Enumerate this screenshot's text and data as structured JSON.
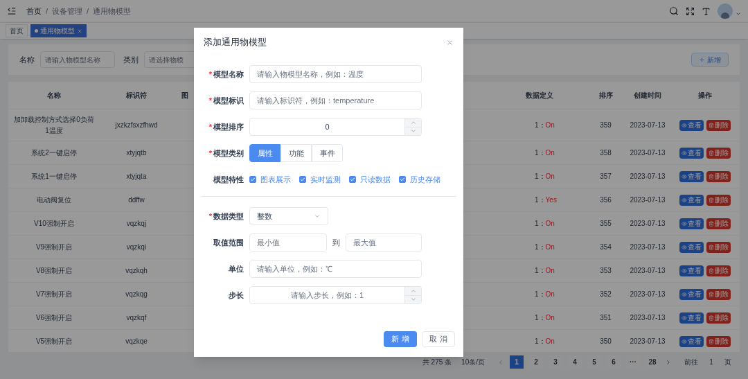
{
  "header": {
    "breadcrumb": [
      "首页",
      "设备管理",
      "通用物模型"
    ],
    "breadcrumb_separator": "/"
  },
  "tabs": [
    {
      "label": "首页",
      "selected": false
    },
    {
      "label": "通用物模型",
      "selected": true
    }
  ],
  "search": {
    "fields": [
      {
        "label": "名称",
        "placeholder": "请输入物模型名称"
      },
      {
        "label": "类别",
        "placeholder": "请选择物模"
      }
    ],
    "add_button": "新增"
  },
  "table": {
    "columns": [
      "名称",
      "标识符",
      "图",
      "数据定义",
      "排序",
      "创建时间",
      "操作"
    ],
    "rows": [
      {
        "name": "加卸载控制方式选择0负荷1温度",
        "identifier": "jxzkzfsxzfhwd",
        "data_key": "1：",
        "data_value": "On",
        "sort": "359",
        "created": "2023-07-13",
        "actions": [
          "查看",
          "删除"
        ]
      },
      {
        "name": "系统2一键启停",
        "identifier": "xtyjqtb",
        "data_key": "1：",
        "data_value": "On",
        "sort": "358",
        "created": "2023-07-13",
        "actions": [
          "查看",
          "删除"
        ]
      },
      {
        "name": "系统1一键启停",
        "identifier": "xtyjqta",
        "data_key": "1：",
        "data_value": "On",
        "sort": "357",
        "created": "2023-07-13",
        "actions": [
          "查看",
          "删除"
        ]
      },
      {
        "name": "电动阀复位",
        "identifier": "ddffw",
        "data_key": "1：",
        "data_value": "Yes",
        "sort": "356",
        "created": "2023-07-13",
        "actions": [
          "查看",
          "删除"
        ]
      },
      {
        "name": "V10强制开启",
        "identifier": "vqzkqj",
        "data_key": "1：",
        "data_value": "On",
        "sort": "355",
        "created": "2023-07-13",
        "actions": [
          "查看",
          "删除"
        ]
      },
      {
        "name": "V9强制开启",
        "identifier": "vqzkqi",
        "data_key": "1：",
        "data_value": "On",
        "sort": "354",
        "created": "2023-07-13",
        "actions": [
          "查看",
          "删除"
        ]
      },
      {
        "name": "V8强制开启",
        "identifier": "vqzkqh",
        "data_key": "1：",
        "data_value": "On",
        "sort": "353",
        "created": "2023-07-13",
        "actions": [
          "查看",
          "删除"
        ]
      },
      {
        "name": "V7强制开启",
        "identifier": "vqzkqg",
        "data_key": "1：",
        "data_value": "On",
        "sort": "352",
        "created": "2023-07-13",
        "actions": [
          "查看",
          "删除"
        ]
      },
      {
        "name": "V6强制开启",
        "identifier": "vqzkqf",
        "data_key": "1：",
        "data_value": "On",
        "sort": "351",
        "created": "2023-07-13",
        "actions": [
          "查看",
          "删除"
        ]
      },
      {
        "name": "V5强制开启",
        "identifier": "vqzkqe",
        "data_key": "1：",
        "data_value": "On",
        "sort": "350",
        "created": "2023-07-13",
        "actions": [
          "查看",
          "删除"
        ]
      }
    ]
  },
  "pagination": {
    "total": "共 275 条",
    "page_size": "10条/页",
    "pages": [
      {
        "label": "1",
        "selected": true
      },
      {
        "label": "2",
        "selected": false
      },
      {
        "label": "3",
        "selected": false
      },
      {
        "label": "4",
        "selected": false
      },
      {
        "label": "5",
        "selected": false
      },
      {
        "label": "6",
        "selected": false
      },
      {
        "label": "···",
        "selected": false
      },
      {
        "label": "28",
        "selected": false
      }
    ],
    "goto_label": "前往",
    "goto_value": "1",
    "goto_suffix": "页"
  },
  "dialog": {
    "title": "添加通用物模型",
    "required_mark": "*",
    "sections": [
      [
        {
          "kind": "text",
          "label": "模型名称",
          "required": true,
          "placeholder": "请输入物模型名称，例如：温度"
        },
        {
          "kind": "text",
          "label": "模型标识",
          "required": true,
          "placeholder": "请输入标识符，例如：temperature"
        },
        {
          "kind": "number",
          "label": "模型排序",
          "required": true,
          "value": "0"
        },
        {
          "kind": "segmented",
          "label": "模型类别",
          "required": true,
          "options": [
            {
              "label": "属性",
              "selected": true
            },
            {
              "label": "功能",
              "selected": false
            },
            {
              "label": "事件",
              "selected": false
            }
          ]
        },
        {
          "kind": "checkboxes",
          "label": "模型特性",
          "required": false,
          "options": [
            {
              "label": "图表展示",
              "checked": true
            },
            {
              "label": "实时监测",
              "checked": true
            },
            {
              "label": "只读数据",
              "checked": true
            },
            {
              "label": "历史存储",
              "checked": true
            }
          ]
        }
      ],
      [
        {
          "kind": "select",
          "label": "数据类型",
          "required": true,
          "value": "整数"
        },
        {
          "kind": "range",
          "label": "取值范围",
          "required": false,
          "min_placeholder": "最小值",
          "separator": "到",
          "max_placeholder": "最大值"
        },
        {
          "kind": "text",
          "label": "单位",
          "required": false,
          "placeholder": "请输入单位，例如：℃"
        },
        {
          "kind": "number",
          "label": "步长",
          "required": false,
          "placeholder": "请输入步长，例如：1"
        }
      ]
    ],
    "buttons": [
      {
        "label": "新 增",
        "kind": "primary"
      },
      {
        "label": "取 消",
        "kind": "default"
      }
    ]
  }
}
